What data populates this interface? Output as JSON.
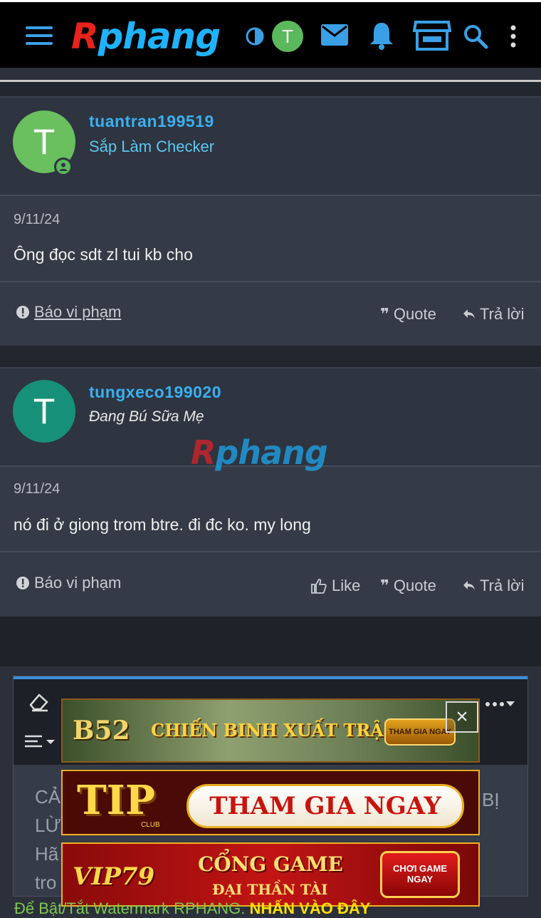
{
  "header": {
    "logo": {
      "first": "R",
      "rest": "phang"
    },
    "avatar_initial": "T",
    "icons": [
      "menu-icon",
      "theme-toggle-icon",
      "mail-icon",
      "bell-icon",
      "store-icon",
      "search-icon",
      "more-vertical-icon"
    ]
  },
  "posts": [
    {
      "username": "tuantran199519",
      "user_title": "Sắp Làm Checker",
      "avatar_initial": "T",
      "avatar_color": "#6abf5e",
      "date": "9/11/24",
      "text": "Ông đọc sdt zl tui kb cho",
      "report_label": "Báo vi phạm",
      "quote_label": "Quote",
      "reply_label": "Trả lời"
    },
    {
      "username": "tungxeco199020",
      "user_title": "Đang Bú Sữa Mẹ",
      "avatar_initial": "T",
      "avatar_color": "#17907a",
      "date": "9/11/24",
      "text": "nó đi ở giong trom btre. đi đc ko. my long",
      "report_label": "Báo vi phạm",
      "like_label": "Like",
      "quote_label": "Quote",
      "reply_label": "Trả lời"
    }
  ],
  "watermark": {
    "first": "R",
    "rest": "phang"
  },
  "editor": {
    "body_lines": [
      "CẢ",
      "BỊ",
      "LỪ",
      "Hã",
      "tro"
    ]
  },
  "ads": [
    {
      "brand": "B52",
      "slogan": "CHIẾN BINH XUẤT TRẬN",
      "cta": "THAM GIA NGAY"
    },
    {
      "brand": "TIP",
      "brand_sub": "CLUB",
      "cta": "THAM GIA NGAY"
    },
    {
      "brand": "VIP79",
      "slogan_line1": "CỔNG GAME",
      "slogan_line2": "ĐẠI THẦN TÀI",
      "cta_line1": "CHƠI GAME",
      "cta_line2": "NGAY"
    }
  ],
  "footer": {
    "text": "Để Bật/Tắt Watermark RPHANG:",
    "highlight": "NHẤN VÀO ĐÂY"
  },
  "colors": {
    "accent": "#3ab0f0",
    "nav_bg": "#000000",
    "post_bg": "#343a46"
  }
}
